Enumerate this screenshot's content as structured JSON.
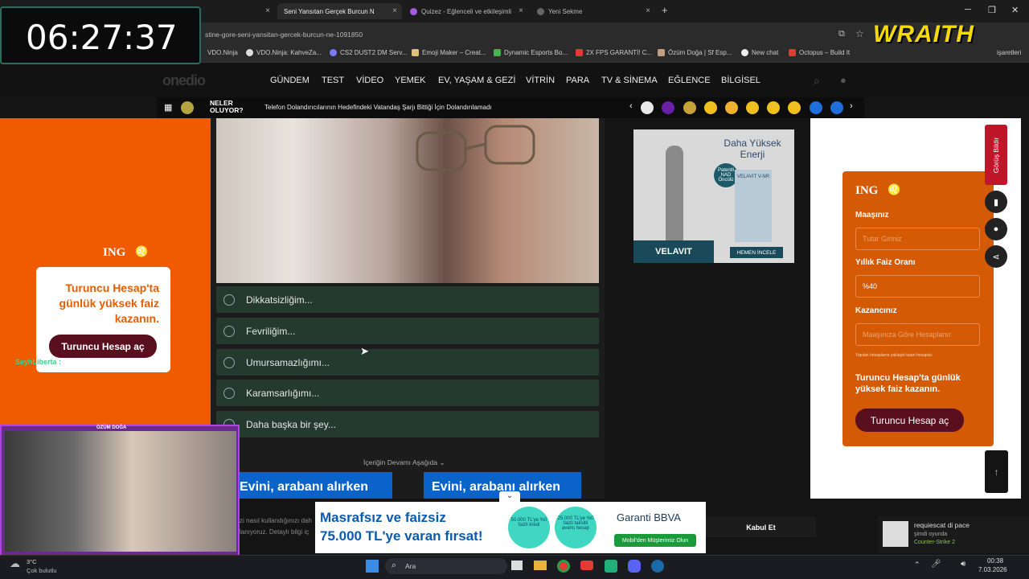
{
  "browser": {
    "tabs": [
      {
        "label": ""
      },
      {
        "label": "Seni Yansıtan Gerçek Burcun N"
      },
      {
        "label": "Quizez - Eğlenceli ve etkileşimli"
      },
      {
        "label": "Yeni Sekme"
      }
    ],
    "new_tab": "+",
    "url": "stine-gore-seni-yansitan-gercek-burcun-ne-1091850",
    "bookmarks": [
      "VDO.Ninja",
      "VDO.Ninja: KahveZa...",
      "CS2 DUST2 DM Serv...",
      "Emoji Maker – Creat...",
      "Dynamic Esports Bo...",
      "2X FPS GARANTİ! C...",
      "Özüm Doğa | Sf Esp...",
      "New chat",
      "Octopus – Build It"
    ],
    "bookmarks_right": "işaretleri"
  },
  "overlay": {
    "timer": "06:27:37",
    "brand": "WRAITH",
    "cam_name": "ÖZÜM DOĞA",
    "chat_user": "SeyhLiberta :"
  },
  "site": {
    "logo": "onedio",
    "nav": [
      "GÜNDEM",
      "TEST",
      "VİDEO",
      "YEMEK",
      "EV, YAŞAM & GEZİ",
      "VİTRİN",
      "PARA",
      "TV & SİNEMA",
      "EĞLENCE",
      "BİLGİSEL"
    ],
    "neler": "NELER OLUYOR?",
    "ticker": "Telefon Dolandırıcılarının Hedefindeki Vatandaş Şarjı Bittiği İçin Dolandırılamadı",
    "options": [
      "Dikkatsizliğim...",
      "Fevriliğim...",
      "Umursamazlığımı...",
      "Karamsarlığımı...",
      "Daha başka bir şey..."
    ],
    "more": "İçeriğin Devamı Aşağıda ⌄",
    "feedback": "Görüş Bildir"
  },
  "left_ad": {
    "brand": "ING",
    "headline": "Turuncu Hesap'ta günlük yüksek faiz kazanın.",
    "button": "Turuncu Hesap aç"
  },
  "right_ad": {
    "title": "Daha Yüksek Enerji",
    "badge": "Patentli NAD Öncülü",
    "product": "VELAVIT V-NR",
    "brand": "VELAVIT",
    "cta": "HEMEN İNCELE"
  },
  "ing_calc": {
    "brand": "ING",
    "label1": "Maaşınız",
    "placeholder1": "Tutar Giriniz",
    "label2": "Yıllık Faiz Oranı",
    "value2": "%40",
    "label3": "Kazancınız",
    "placeholder3": "Maaşınıza Göre Hesaplanır",
    "note": "Yapılan hesaplama yaklaşık tutarı hesaplar.",
    "headline": "Turuncu Hesap'ta günlük yüksek faiz kazanın.",
    "button": "Turuncu Hesap aç"
  },
  "bottom": {
    "ad_small1": "Evini, arabanı alırken",
    "ad_small2": "Evini, arabanı alırken",
    "cookie1": "zi nasıl kullandığınızı dah",
    "cookie2": "lanıyoruz. Detaylı bilgi iç",
    "accept": "Kabul Et",
    "banner_line1": "Masrafsız ve faizsiz",
    "banner_line2": "75.000 TL'ye varan fırsat!",
    "circle1": "50.000 TL'ye %0 faizli kredi",
    "circle2": "25.000 TL'ye %0 faizli taksitli avans hesap",
    "bank": "Garanti BBVA",
    "bank_cta": "Mobil'den Müşterimiz Olun"
  },
  "notification": {
    "title": "requiescat di pace",
    "sub": "şimdi oyunda",
    "game": "Counter-Strike 2"
  },
  "taskbar": {
    "weather_temp": "3°C",
    "weather_desc": "Çok bulutlu",
    "search": "Ara",
    "time": "00:38",
    "date": "7.03.2026"
  }
}
